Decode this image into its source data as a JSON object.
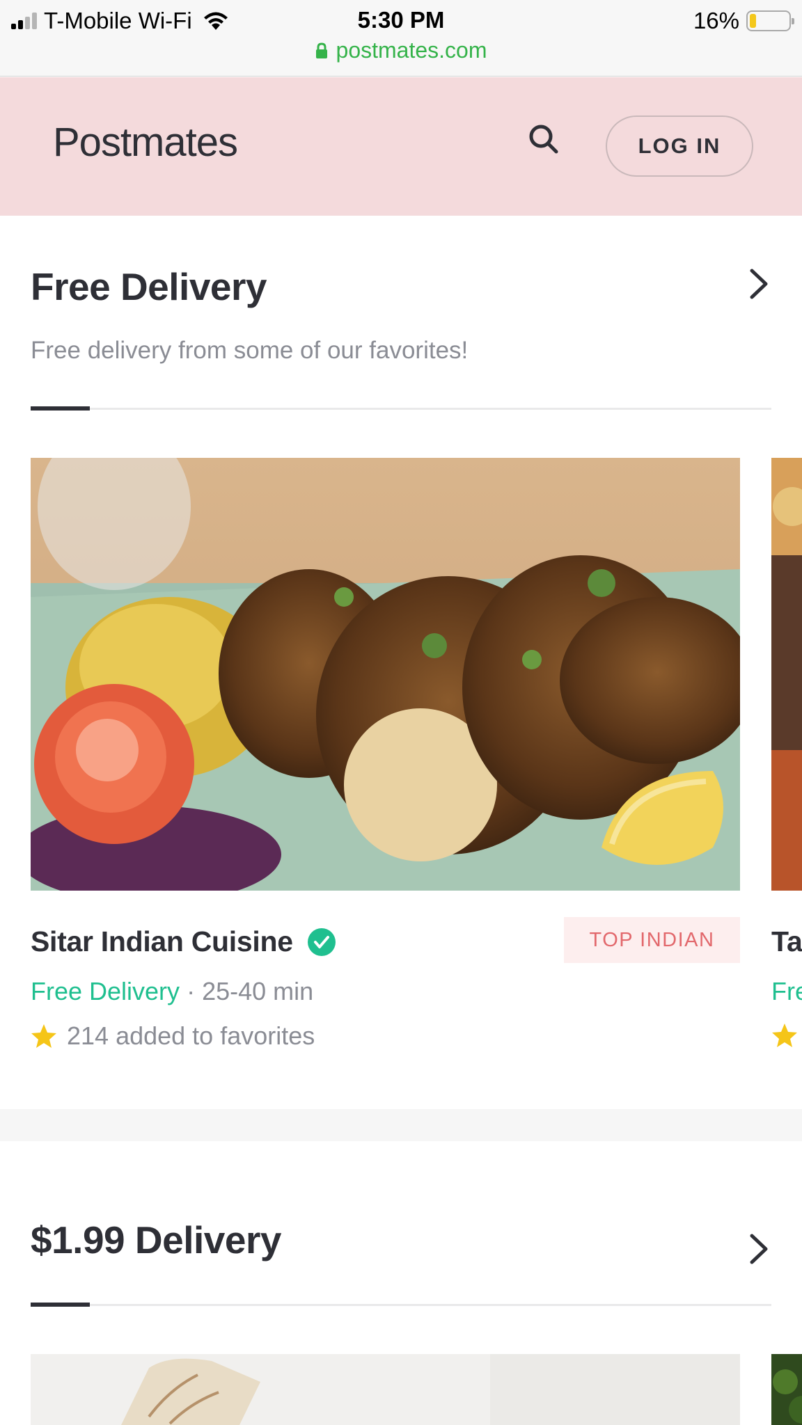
{
  "status_bar": {
    "carrier": "T-Mobile Wi-Fi",
    "time": "5:30 PM",
    "battery_percent": "16%",
    "battery_level": 0.16,
    "url": "postmates.com"
  },
  "header": {
    "brand": "Postmates",
    "login_label": "LOG IN"
  },
  "sections": {
    "free_delivery": {
      "title": "Free Delivery",
      "subtitle": "Free delivery from some of our favorites!",
      "scroll_progress": 0.08
    },
    "paid_delivery": {
      "title": "$1.99 Delivery",
      "scroll_progress": 0.08
    }
  },
  "store_card": {
    "name": "Sitar Indian Cuisine",
    "tag": "TOP INDIAN",
    "delivery": "Free Delivery",
    "separator": " · ",
    "eta": "25-40 min",
    "favorites": "214 added to favorites"
  },
  "peek_card": {
    "name_partial": "Ta",
    "delivery_partial": "Fre"
  },
  "colors": {
    "brand_pink": "#f4dadc",
    "accent_green": "#1fbf8f",
    "url_green": "#35b34a",
    "tag_red": "#e2686c",
    "star_yellow": "#f5c518"
  }
}
